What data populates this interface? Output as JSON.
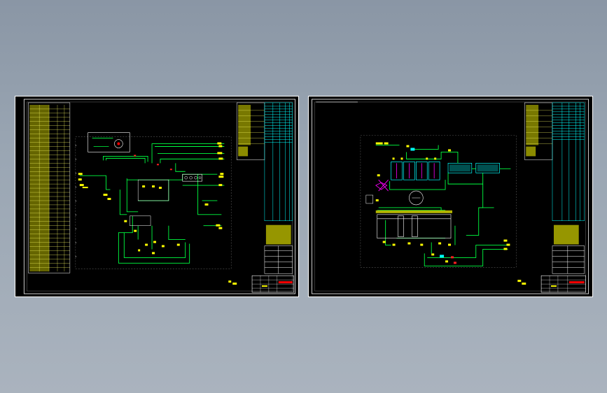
{
  "viewer": {
    "background": "#9aa6b3"
  },
  "sheets": [
    {
      "name": "piping-diagram-sheet-1",
      "colors": {
        "frame": "#ffffff",
        "line": "#00ff40",
        "text": "#ffff00",
        "table": "#00ffff",
        "accent": "#ff0000"
      }
    },
    {
      "name": "piping-diagram-sheet-2",
      "colors": {
        "frame": "#ffffff",
        "line": "#00ff40",
        "text": "#ffff00",
        "table": "#00ffff",
        "accent": "#ff00ff"
      }
    }
  ]
}
